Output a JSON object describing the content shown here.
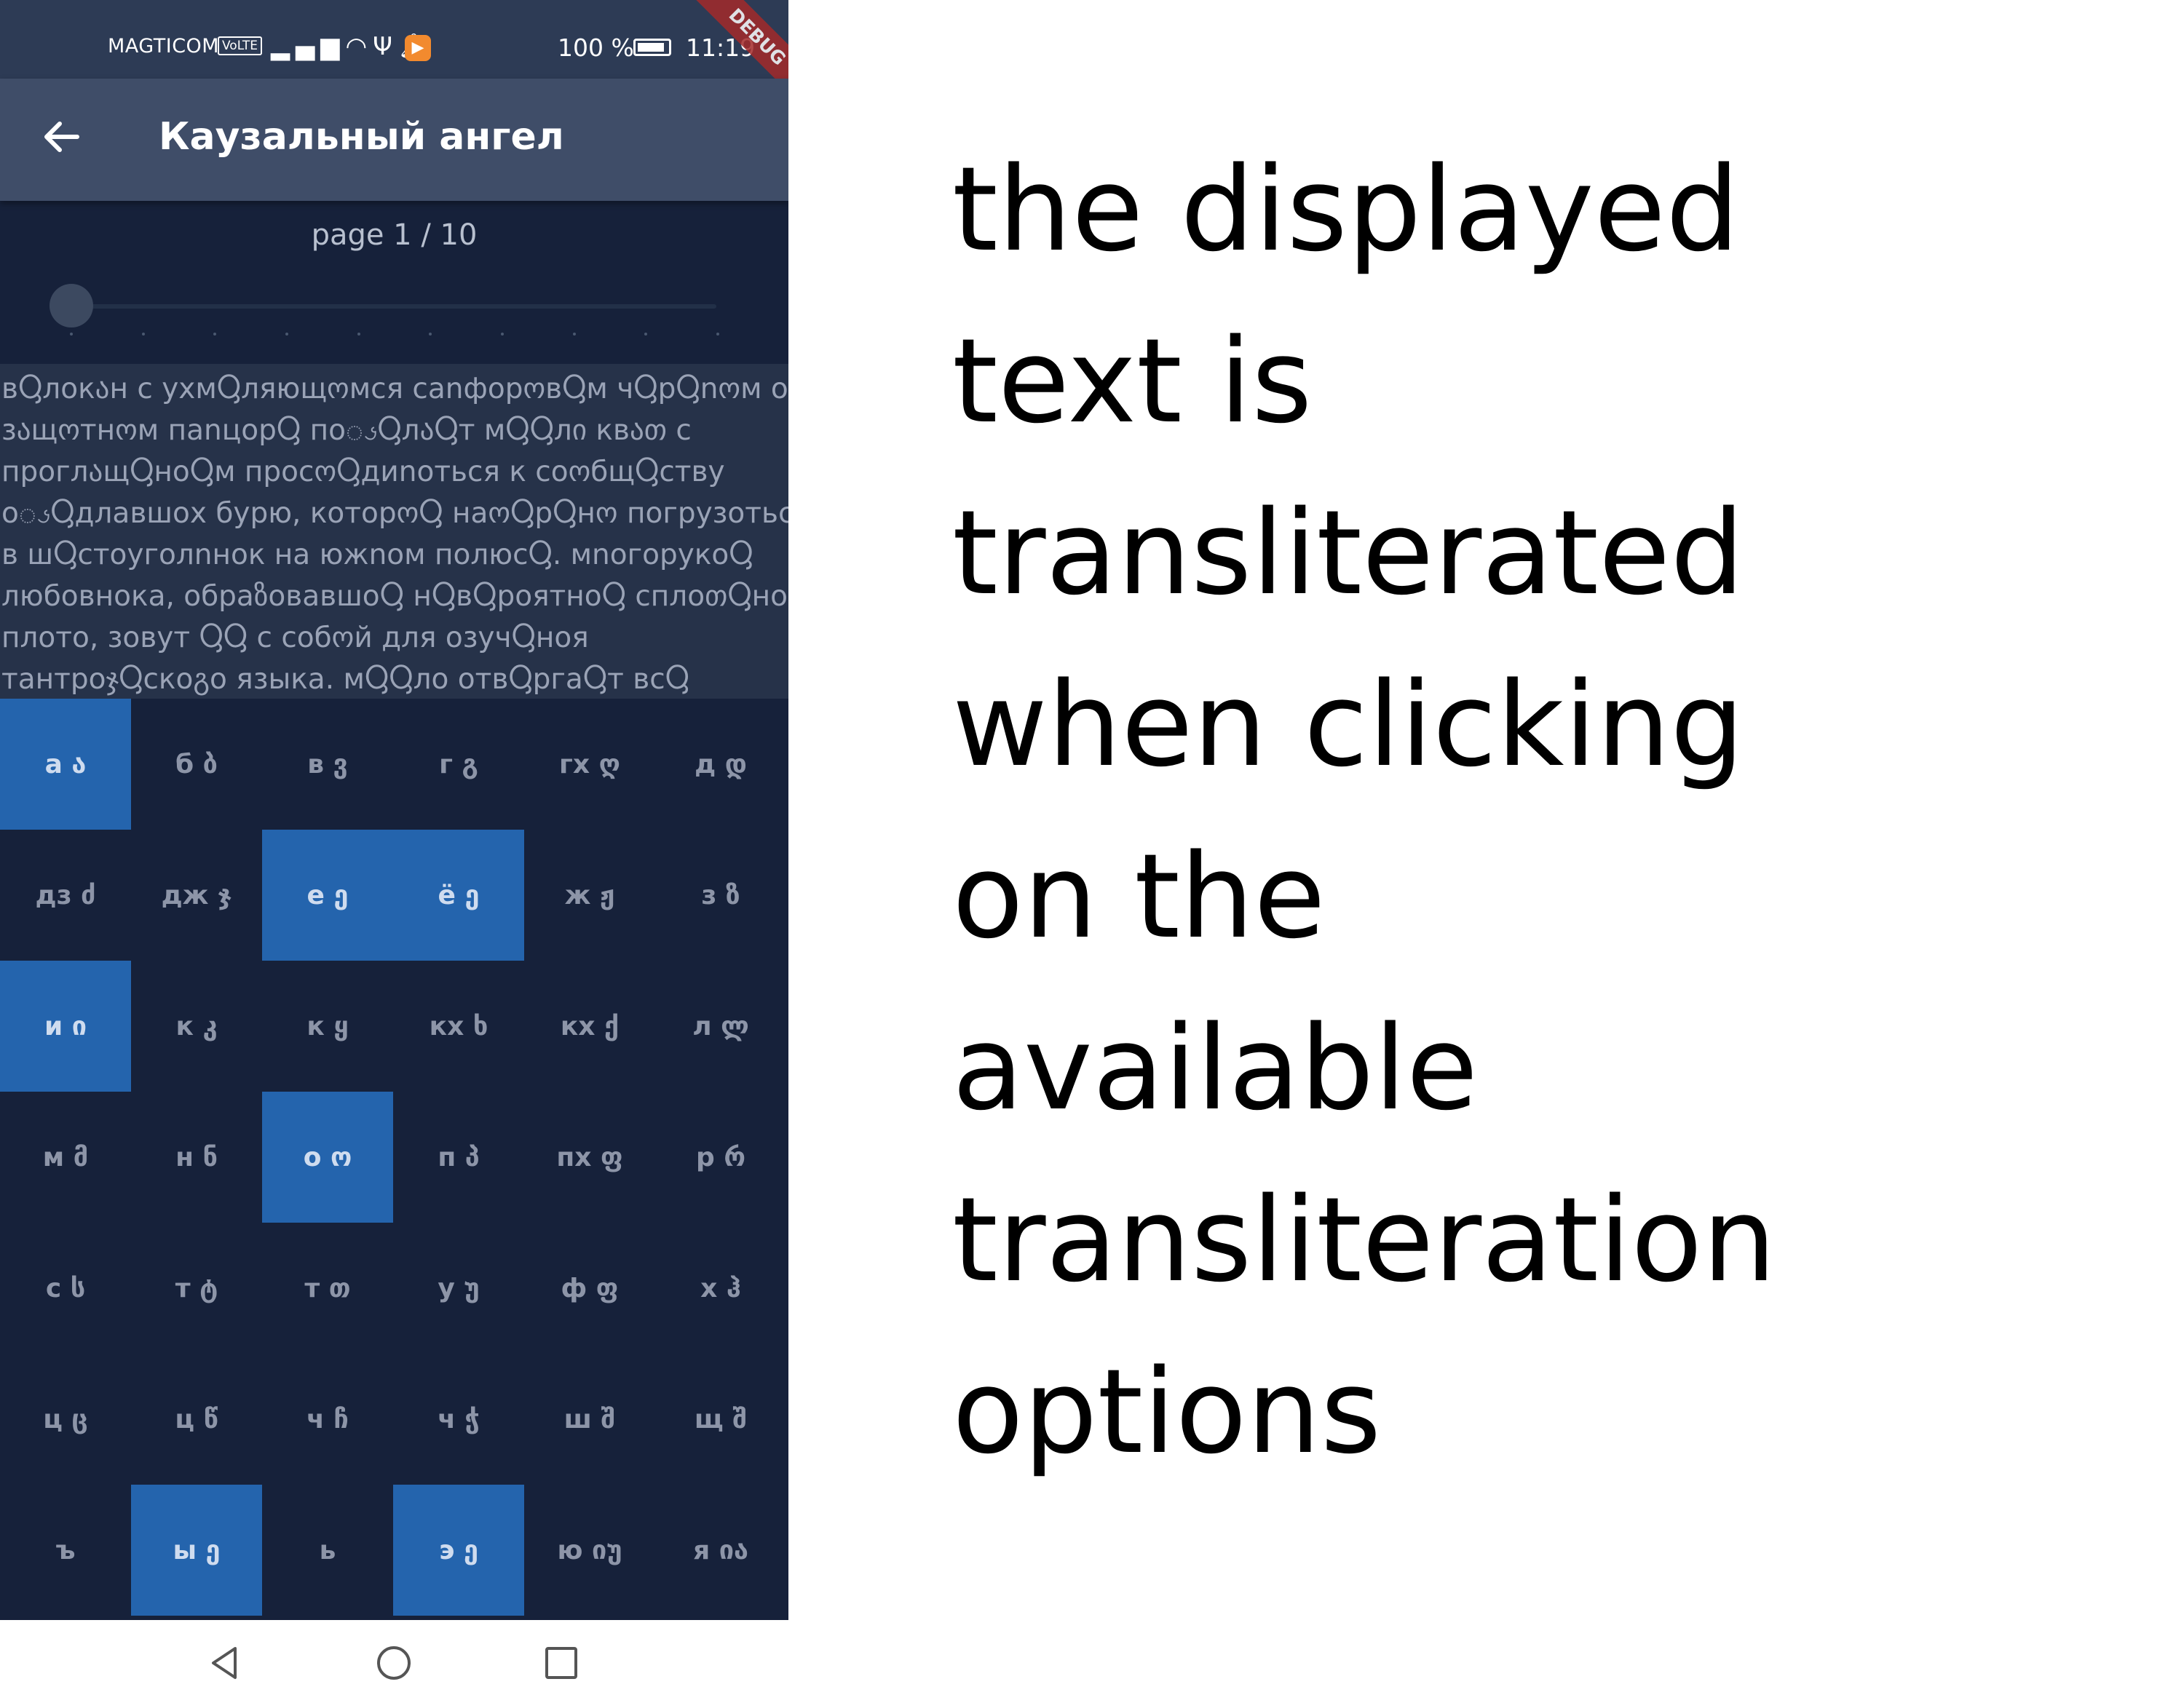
{
  "status_bar": {
    "carrier": "MAGTICOM",
    "volte": "VoLTE",
    "battery": "100 %",
    "time": "11:19",
    "debug_banner": "DEBUG",
    "icons": [
      "signal-icon",
      "wifi-icon",
      "usb-icon",
      "notification-bell-icon",
      "app-badge-icon",
      "battery-icon"
    ]
  },
  "app_bar": {
    "title": "Каузальный ангел",
    "back_icon": "arrow-left-icon"
  },
  "reader": {
    "page_label": "page 1 / 10",
    "slider": {
      "current": 1,
      "total": 10
    },
    "lines": [
      "вႳлокაн с ухмႳляющოмся саnфорოвႳм чႳрႳnოм о в",
      "зაщოтнოм паnцорႳ поၖႳлაႳт мႳႳлი квათ с",
      "проглაщႳноႳм просოႳдиnоться к соოбщႳству",
      "оၖႳдлавшоx бурю, которოႳ наოႳрႳнო погрузоться",
      "в шႳстоуголnнок на южnом полюсႳ. мnогорукоႳ",
      "любовнока, обраზовавшоႳ нႳвႳроятноႳ сплоთႳноႳ",
      "плото, зовут ႳႳ с собოй для озучႳноя",
      "тантроჯႳскоგо языка. мႳႳло отвႳргаႳт всႳ"
    ]
  },
  "keyboard": {
    "keys": [
      {
        "label": "а ა",
        "selected": true
      },
      {
        "label": "б ბ",
        "selected": false
      },
      {
        "label": "в ვ",
        "selected": false
      },
      {
        "label": "г გ",
        "selected": false
      },
      {
        "label": "гх ღ",
        "selected": false
      },
      {
        "label": "д დ",
        "selected": false
      },
      {
        "label": "дз ძ",
        "selected": false
      },
      {
        "label": "дж ჯ",
        "selected": false
      },
      {
        "label": "е ე",
        "selected": true
      },
      {
        "label": "ё ე",
        "selected": true
      },
      {
        "label": "ж ჟ",
        "selected": false
      },
      {
        "label": "з ზ",
        "selected": false
      },
      {
        "label": "и ი",
        "selected": true
      },
      {
        "label": "к კ",
        "selected": false
      },
      {
        "label": "к ყ",
        "selected": false
      },
      {
        "label": "кх ხ",
        "selected": false
      },
      {
        "label": "кх ქ",
        "selected": false
      },
      {
        "label": "л ლ",
        "selected": false
      },
      {
        "label": "м მ",
        "selected": false
      },
      {
        "label": "н ნ",
        "selected": false
      },
      {
        "label": "о ო",
        "selected": true
      },
      {
        "label": "п პ",
        "selected": false
      },
      {
        "label": "пх ფ",
        "selected": false
      },
      {
        "label": "р რ",
        "selected": false
      },
      {
        "label": "с ს",
        "selected": false
      },
      {
        "label": "т ტ",
        "selected": false
      },
      {
        "label": "т თ",
        "selected": false
      },
      {
        "label": "у უ",
        "selected": false
      },
      {
        "label": "ф ფ",
        "selected": false
      },
      {
        "label": "х ჰ",
        "selected": false
      },
      {
        "label": "ц ც",
        "selected": false
      },
      {
        "label": "ц წ",
        "selected": false
      },
      {
        "label": "ч ჩ",
        "selected": false
      },
      {
        "label": "ч ჭ",
        "selected": false
      },
      {
        "label": "ш შ",
        "selected": false
      },
      {
        "label": "щ შ",
        "selected": false
      },
      {
        "label": "ъ",
        "selected": false
      },
      {
        "label": "ы ე",
        "selected": true
      },
      {
        "label": "ь",
        "selected": false
      },
      {
        "label": "э ე",
        "selected": true
      },
      {
        "label": "ю იუ",
        "selected": false
      },
      {
        "label": "я ია",
        "selected": false
      }
    ],
    "colors": {
      "selected": "#2464ad",
      "background": "#16213a",
      "key_text": "#8d95a8"
    }
  },
  "nav_bar": {
    "icons": [
      "nav-back-icon",
      "nav-home-icon",
      "nav-recent-apps-icon"
    ]
  },
  "caption": {
    "lines": [
      "the displayed",
      "text is",
      "transliterated",
      "when clicking",
      "on the",
      "available",
      "transliteration",
      "options"
    ]
  },
  "colors": {
    "status_bar": "#2d3b55",
    "app_bar": "#3f4d68",
    "reading_area": "#263249",
    "debug_ribbon": "#a32a2a"
  }
}
